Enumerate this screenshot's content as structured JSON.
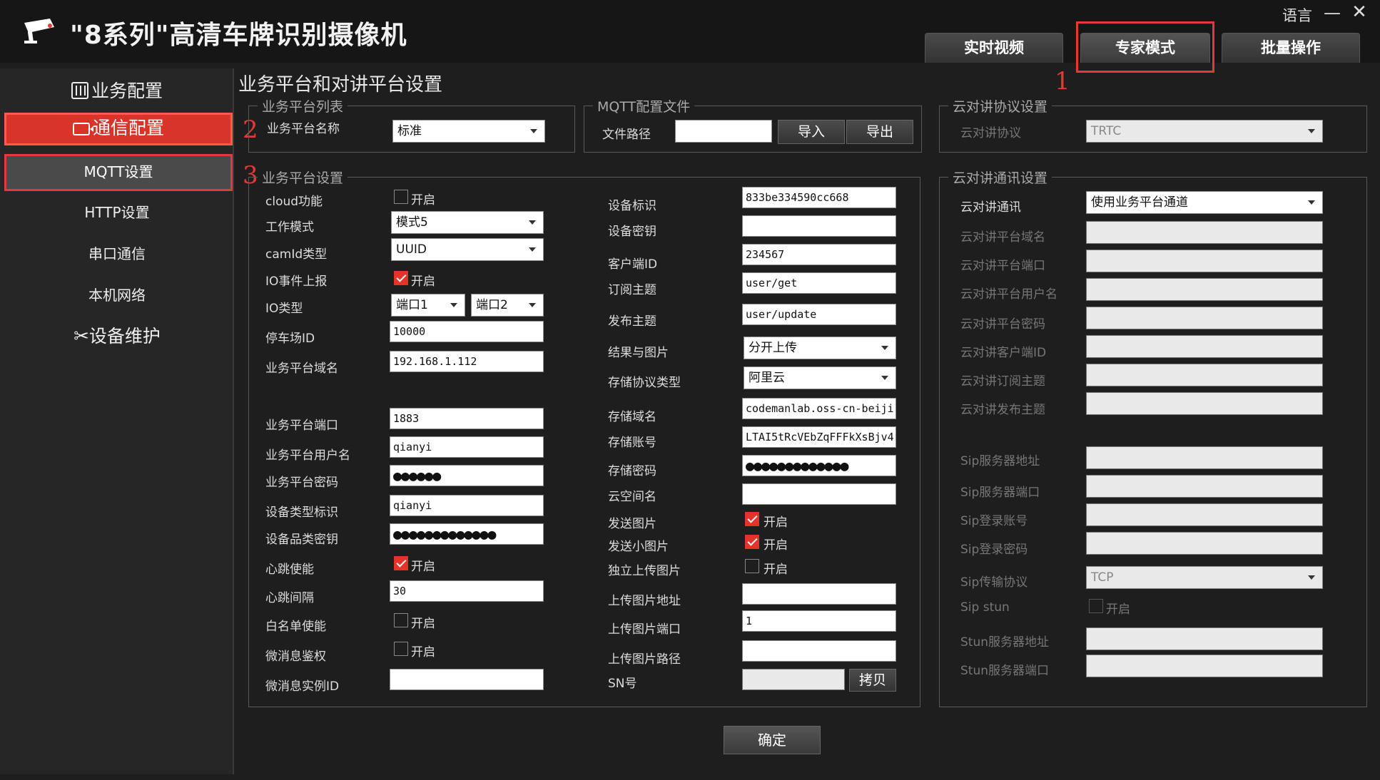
{
  "app": {
    "title": "\"8系列\"高清车牌识别摄像机",
    "language_label": "语言",
    "minimize": "—",
    "close": "✕"
  },
  "tabs": [
    {
      "label": "实时视频"
    },
    {
      "label": "专家模式"
    },
    {
      "label": "批量操作"
    }
  ],
  "annotations": {
    "one": "1",
    "two": "2",
    "three": "3",
    "accent_color": "#e53935"
  },
  "sidebar": {
    "business_config": "业务配置",
    "comm_config": "通信配置",
    "mqtt": "MQTT设置",
    "http": "HTTP设置",
    "serial": "串口通信",
    "network": "本机网络",
    "maintenance": "设备维护"
  },
  "page_title": "业务平台和对讲平台设置",
  "platform_list": {
    "title": "业务平台列表",
    "name_label": "业务平台名称",
    "name_value": "标准"
  },
  "mqtt_file": {
    "title": "MQTT配置文件",
    "path_label": "文件路径",
    "path_value": "",
    "import": "导入",
    "export": "导出"
  },
  "talk_protocol": {
    "title": "云对讲协议设置",
    "protocol_label": "云对讲协议",
    "protocol_value": "TRTC"
  },
  "platform_settings": {
    "title": "业务平台设置",
    "check_label": "开启",
    "left": {
      "cloud_label": "cloud功能",
      "cloud_checked": false,
      "work_mode_label": "工作模式",
      "work_mode_value": "模式5",
      "camid_label": "camId类型",
      "camid_value": "UUID",
      "io_event_label": "IO事件上报",
      "io_event_checked": true,
      "io_type_label": "IO类型",
      "io_port1": "端口1",
      "io_port2": "端口2",
      "parking_label": "停车场ID",
      "parking_value": "10000",
      "domain_label": "业务平台域名",
      "domain_value": "192.168.1.112",
      "port_label": "业务平台端口",
      "port_value": "1883",
      "user_label": "业务平台用户名",
      "user_value": "qianyi",
      "password_label": "业务平台密码",
      "password_value": "●●●●●●",
      "device_type_label": "设备类型标识",
      "device_type_value": "qianyi",
      "category_key_label": "设备品类密钥",
      "category_key_value": "●●●●●●●●●●●●●",
      "heartbeat_label": "心跳使能",
      "heartbeat_checked": true,
      "interval_label": "心跳间隔",
      "interval_value": "30",
      "whitelist_label": "白名单使能",
      "whitelist_checked": false,
      "wechat_auth_label": "微消息鉴权",
      "wechat_auth_checked": false,
      "wechat_id_label": "微消息实例ID",
      "wechat_id_value": ""
    },
    "right": {
      "device_id_label": "设备标识",
      "device_id_value": "833be334590cc668",
      "device_key_label": "设备密钥",
      "device_key_value": "",
      "client_id_label": "客户端ID",
      "client_id_value": "234567",
      "sub_topic_label": "订阅主题",
      "sub_topic_value": "user/get",
      "pub_topic_label": "发布主题",
      "pub_topic_value": "user/update",
      "result_label": "结果与图片",
      "result_value": "分开上传",
      "storage_type_label": "存储协议类型",
      "storage_type_value": "阿里云",
      "storage_domain_label": "存储域名",
      "storage_domain_value": "codemanlab.oss-cn-beiji",
      "storage_account_label": "存储账号",
      "storage_account_value": "LTAI5tRcVEbZqFFFkXsBjv4",
      "storage_password_label": "存储密码",
      "storage_password_value": "●●●●●●●●●●●●●",
      "bucket_label": "云空间名",
      "bucket_value": "",
      "send_image_label": "发送图片",
      "send_image_checked": true,
      "send_small_label": "发送小图片",
      "send_small_checked": true,
      "independent_label": "独立上传图片",
      "independent_checked": false,
      "upload_addr_label": "上传图片地址",
      "upload_addr_value": "",
      "upload_port_label": "上传图片端口",
      "upload_port_value": "1",
      "upload_path_label": "上传图片路径",
      "upload_path_value": "",
      "sn_label": "SN号",
      "sn_value": "",
      "copy_label": "拷贝"
    }
  },
  "talk_comm": {
    "title": "云对讲通讯设置",
    "comm_label": "云对讲通讯",
    "comm_value": "使用业务平台通道",
    "fields": [
      {
        "label": "云对讲平台域名",
        "value": ""
      },
      {
        "label": "云对讲平台端口",
        "value": ""
      },
      {
        "label": "云对讲平台用户名",
        "value": ""
      },
      {
        "label": "云对讲平台密码",
        "value": ""
      },
      {
        "label": "云对讲客户端ID",
        "value": ""
      },
      {
        "label": "云对讲订阅主题",
        "value": ""
      },
      {
        "label": "云对讲发布主题",
        "value": ""
      }
    ],
    "sip_fields": [
      {
        "label": "Sip服务器地址",
        "value": ""
      },
      {
        "label": "Sip服务器端口",
        "value": ""
      },
      {
        "label": "Sip登录账号",
        "value": ""
      },
      {
        "label": "Sip登录密码",
        "value": ""
      }
    ],
    "sip_protocol_label": "Sip传输协议",
    "sip_protocol_value": "TCP",
    "sip_stun_label": "Sip stun",
    "sip_stun_check": "开启",
    "sip_stun_checked": false,
    "stun_fields": [
      {
        "label": "Stun服务器地址",
        "value": ""
      },
      {
        "label": "Stun服务器端口",
        "value": ""
      }
    ]
  },
  "confirm": "确定"
}
